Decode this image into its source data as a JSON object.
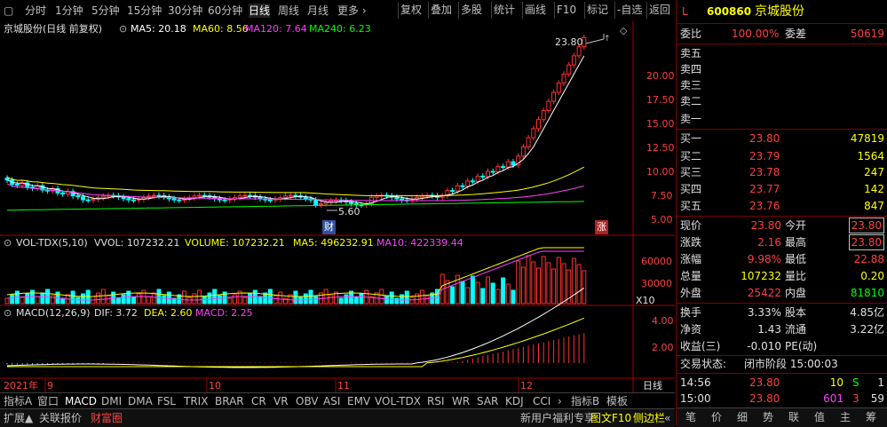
{
  "top_bar": {
    "periods": [
      "分时",
      "1分钟",
      "5分钟",
      "15分钟",
      "30分钟",
      "60分钟",
      "日线",
      "周线",
      "月线",
      "更多 ›"
    ],
    "active_period": "日线",
    "buttons": [
      "复权",
      "叠加",
      "多股",
      "统计",
      "画线",
      "F10",
      "标记",
      "-自选",
      "返回"
    ]
  },
  "main_info": {
    "title": "京城股份(日线 前复权)",
    "ma5": "MA5: 20.18",
    "ma60": "MA60: 8.56",
    "ma120": "MA120: 7.64",
    "ma240": "MA240: 6.23",
    "high_mark": "23.80",
    "low_mark": "5.60",
    "flag_cai": "财",
    "flag_zhang": "涨"
  },
  "vol_info": {
    "name": "VOL-TDX(5,10)",
    "vvol": "VVOL: 107232.21",
    "volume": "VOLUME: 107232.21",
    "ma5": "MA5: 496232.91",
    "ma10": "MA10: 422339.44",
    "multiplier": "X10"
  },
  "macd_info": {
    "name": "MACD(12,26,9)",
    "dif": "DIF: 3.72",
    "dea": "DEA: 2.60",
    "macd": "MACD: 2.25"
  },
  "price_axis": [
    "20.00",
    "17.50",
    "15.00",
    "12.50",
    "10.00",
    "7.50",
    "5.00"
  ],
  "vol_axis": [
    "60000",
    "30000"
  ],
  "macd_axis": [
    "4.00",
    "2.00"
  ],
  "date_labels": [
    "2021年",
    "9",
    "10",
    "11",
    "12"
  ],
  "daily_label": "日线",
  "indicator_tabs": [
    "指标A",
    "窗口",
    "MACD",
    "DMI",
    "DMA",
    "FSL",
    "TRIX",
    "BRAR",
    "CR",
    "VR",
    "OBV",
    "ASI",
    "EMV",
    "VOL-TDX",
    "RSI",
    "WR",
    "SAR",
    "KDJ",
    "CCI",
    "›",
    "指标B",
    "模板"
  ],
  "active_indicator": "MACD",
  "bottom_tabs": [
    "扩展▲",
    "关联报价",
    "财富圈"
  ],
  "bottom_right": [
    "新用户福利专享",
    "图文F10",
    "侧边栏",
    "«"
  ],
  "quote": {
    "flag": "L",
    "code": "600860",
    "name": "京城股份",
    "weibi_label": "委比",
    "weibi": "100.00%",
    "weicha_label": "委差",
    "weicha": "50619",
    "sells": [
      {
        "label": "卖五",
        "price": "",
        "vol": ""
      },
      {
        "label": "卖四",
        "price": "",
        "vol": ""
      },
      {
        "label": "卖三",
        "price": "",
        "vol": ""
      },
      {
        "label": "卖二",
        "price": "",
        "vol": ""
      },
      {
        "label": "卖一",
        "price": "",
        "vol": ""
      }
    ],
    "buys": [
      {
        "label": "买一",
        "price": "23.80",
        "vol": "47819"
      },
      {
        "label": "买二",
        "price": "23.79",
        "vol": "1564"
      },
      {
        "label": "买三",
        "price": "23.78",
        "vol": "247"
      },
      {
        "label": "买四",
        "price": "23.77",
        "vol": "142"
      },
      {
        "label": "买五",
        "price": "23.76",
        "vol": "847"
      }
    ],
    "stats": [
      {
        "l1": "现价",
        "v1": "23.80",
        "l2": "今开",
        "v2": "23.80"
      },
      {
        "l1": "涨跌",
        "v1": "2.16",
        "l2": "最高",
        "v2": "23.80"
      },
      {
        "l1": "涨幅",
        "v1": "9.98%",
        "l2": "最低",
        "v2": "22.88"
      },
      {
        "l1": "总量",
        "v1": "107232",
        "l2": "量比",
        "v2": "0.20"
      },
      {
        "l1": "外盘",
        "v1": "25422",
        "l2": "内盘",
        "v2": "81810"
      }
    ],
    "stats2": [
      {
        "l1": "换手",
        "v1": "3.33%",
        "l2": "股本",
        "v2": "4.85亿"
      },
      {
        "l1": "净资",
        "v1": "1.43",
        "l2": "流通",
        "v2": "3.22亿"
      },
      {
        "l1": "收益(三)",
        "v1": "-0.010",
        "l2": "PE(动)",
        "v2": ""
      }
    ],
    "status_label": "交易状态:",
    "status_value": "闭市阶段 15:00:03",
    "ticks": [
      {
        "time": "14:56",
        "price": "23.80",
        "vol": "10",
        "bs": "S",
        "num": "1"
      },
      {
        "time": "15:00",
        "price": "23.80",
        "vol": "601",
        "bs": "3",
        "num": "59"
      }
    ],
    "bottom_tabs": [
      "笔",
      "价",
      "细",
      "势",
      "联",
      "值",
      "主",
      "筹"
    ]
  },
  "colors": {
    "up": "#ff3030",
    "down": "#00ffff",
    "ma5": "#ffffff",
    "ma60": "#ffff00",
    "ma120": "#ff40ff",
    "ma240": "#00ff00",
    "axis_line": "#a00000"
  }
}
